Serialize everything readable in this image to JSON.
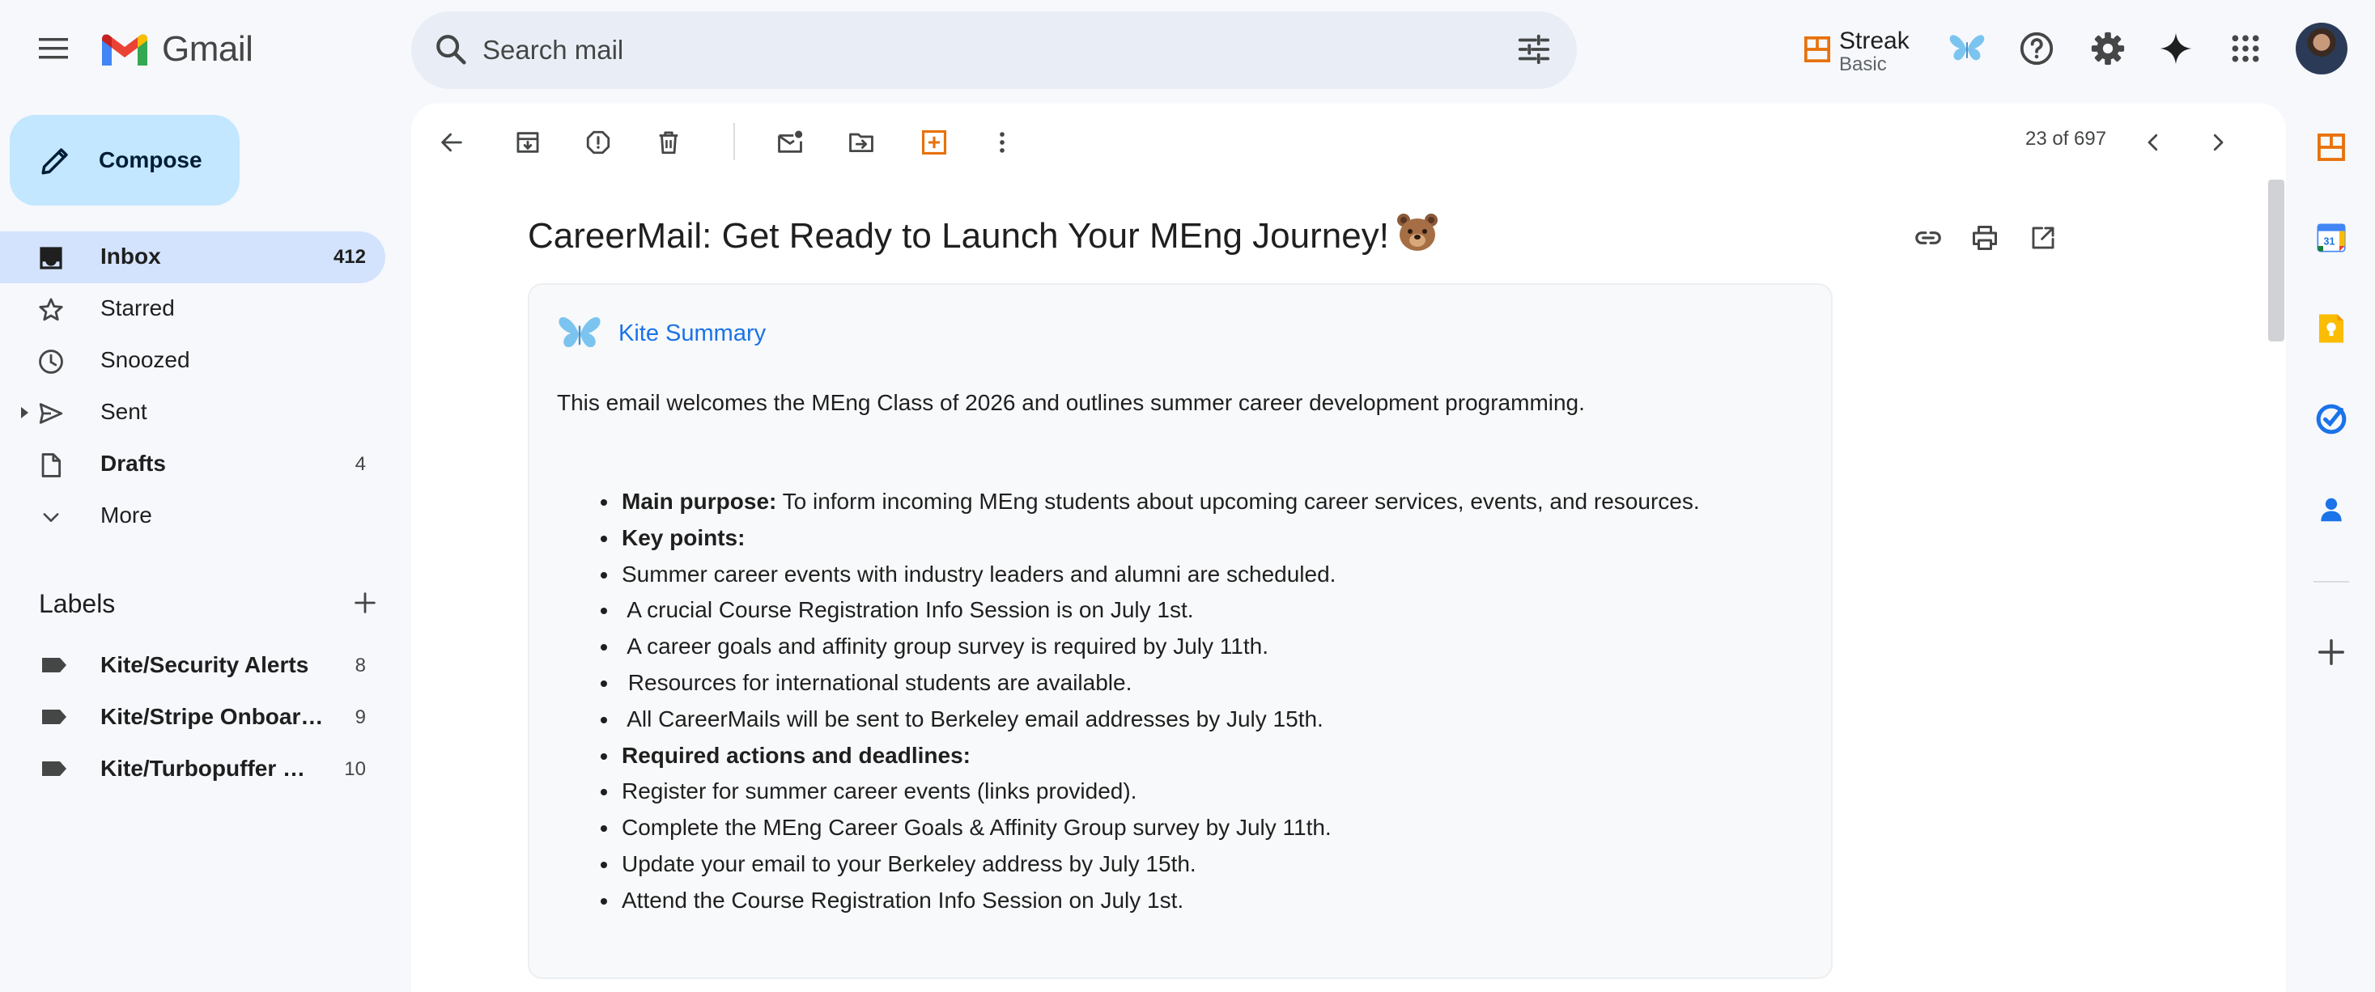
{
  "app": {
    "name": "Gmail",
    "brand_colors": {
      "red": "#ea4335",
      "blue": "#4285f4",
      "green": "#34a853",
      "yellow": "#fbbc04"
    }
  },
  "search": {
    "placeholder": "Search mail"
  },
  "streak": {
    "name": "Streak",
    "plan": "Basic"
  },
  "header_icons": [
    "menu-icon",
    "search-icon",
    "tune-icon",
    "kite-butterfly-icon",
    "help-icon",
    "settings-icon",
    "gemini-sparkle-icon",
    "apps-grid-icon",
    "avatar"
  ],
  "compose": {
    "label": "Compose"
  },
  "nav": {
    "items": [
      {
        "label": "Inbox",
        "count": "412",
        "icon": "inbox-icon",
        "active": true
      },
      {
        "label": "Starred",
        "count": "",
        "icon": "star-icon"
      },
      {
        "label": "Snoozed",
        "count": "",
        "icon": "clock-icon"
      },
      {
        "label": "Sent",
        "count": "",
        "icon": "send-icon"
      },
      {
        "label": "Drafts",
        "count": "4",
        "icon": "draft-icon"
      },
      {
        "label": "More",
        "count": "",
        "icon": "chevron-down-icon"
      }
    ]
  },
  "labels": {
    "title": "Labels",
    "items": [
      {
        "name": "Kite/Security Alerts",
        "count": "8"
      },
      {
        "name": "Kite/Stripe Onboarding",
        "count": "9"
      },
      {
        "name": "Kite/Turbopuffer Updates",
        "count": "10"
      }
    ]
  },
  "toolbar": {
    "icons": [
      "back-icon",
      "archive-icon",
      "report-spam-icon",
      "delete-icon",
      "mark-unread-icon",
      "move-to-icon",
      "streak-box-icon",
      "more-vert-icon"
    ],
    "pager": "23 of 697"
  },
  "email": {
    "subject": "CareerMail: Get Ready to Launch Your MEng Journey!",
    "subject_emoji": "bear-face",
    "actions": [
      "link-icon",
      "print-icon",
      "open-new-window-icon"
    ]
  },
  "kite_summary": {
    "title": "Kite Summary",
    "intro": "This email welcomes the MEng Class of 2026 and outlines summer career development programming.",
    "items": [
      {
        "bold": "Main purpose:",
        "text": " To inform incoming MEng students about upcoming career services, events, and resources."
      },
      {
        "bold": "Key points:",
        "text": ""
      },
      {
        "bold": "",
        "text": "Summer career events with industry leaders and alumni are scheduled."
      },
      {
        "bold": "",
        "text": " A crucial Course Registration Info Session is on July 1st."
      },
      {
        "bold": "",
        "text": " A career goals and affinity group survey is required by July 11th."
      },
      {
        "bold": "",
        "text": " Resources for international students are available."
      },
      {
        "bold": "",
        "text": " All CareerMails will be sent to Berkeley email addresses by July 15th."
      },
      {
        "bold": "Required actions and deadlines:",
        "text": ""
      },
      {
        "bold": "",
        "text": "Register for summer career events (links provided)."
      },
      {
        "bold": "",
        "text": "Complete the MEng Career Goals & Affinity Group survey by July 11th."
      },
      {
        "bold": "",
        "text": "Update your email to your Berkeley address by July 15th."
      },
      {
        "bold": "",
        "text": "Attend the Course Registration Info Session on July 1st."
      }
    ]
  },
  "side_panel": {
    "icons": [
      "streak-panel-icon",
      "calendar-icon",
      "keep-icon",
      "tasks-icon",
      "contacts-icon",
      "add-addon-icon"
    ],
    "calendar_day": "31"
  }
}
